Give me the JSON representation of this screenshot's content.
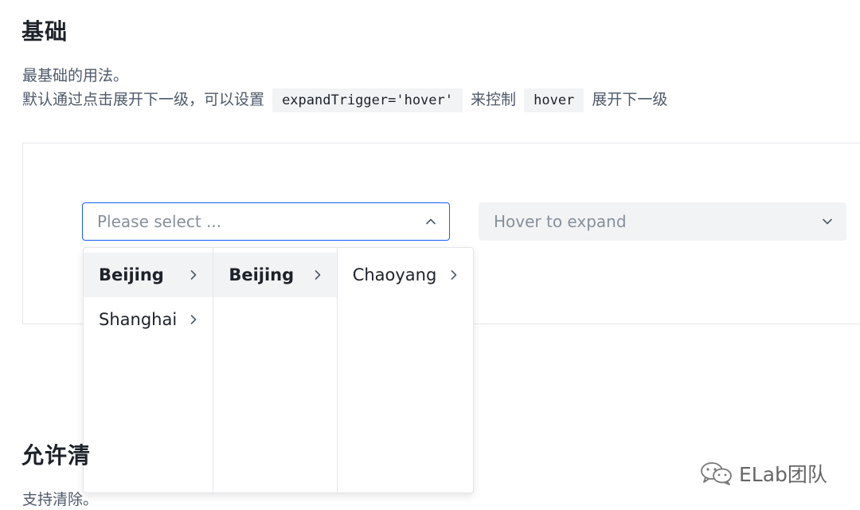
{
  "section1": {
    "title": "基础",
    "desc_line1": "最基础的用法。",
    "desc_line2_part1": "默认通过点击展开下一级，可以设置",
    "code1": "expandTrigger='hover'",
    "desc_line2_part2": "来控制",
    "code2": "hover",
    "desc_line2_part3": "展开下一级"
  },
  "cascader1": {
    "placeholder": "Please select ...",
    "state": "open",
    "arrow_icon": "chevron-up-icon"
  },
  "cascader2": {
    "placeholder": "Hover to expand",
    "state": "disabled",
    "arrow_icon": "chevron-down-icon"
  },
  "popup": {
    "columns": [
      {
        "items": [
          {
            "label": "Beijing",
            "active": true
          },
          {
            "label": "Shanghai",
            "active": false
          }
        ]
      },
      {
        "items": [
          {
            "label": "Beijing",
            "active": true
          }
        ]
      },
      {
        "items": [
          {
            "label": "Chaoyang",
            "active": false
          }
        ]
      }
    ]
  },
  "section2": {
    "title": "允许清",
    "desc": "支持清除。"
  },
  "watermark": {
    "text": "ELab团队",
    "icon": "wechat-icon"
  },
  "colors": {
    "primary": "#165dff",
    "text": "#1d2129",
    "text_secondary": "#4e5969",
    "placeholder": "#86909c",
    "fill": "#f2f3f5",
    "border": "#e5e6eb"
  }
}
